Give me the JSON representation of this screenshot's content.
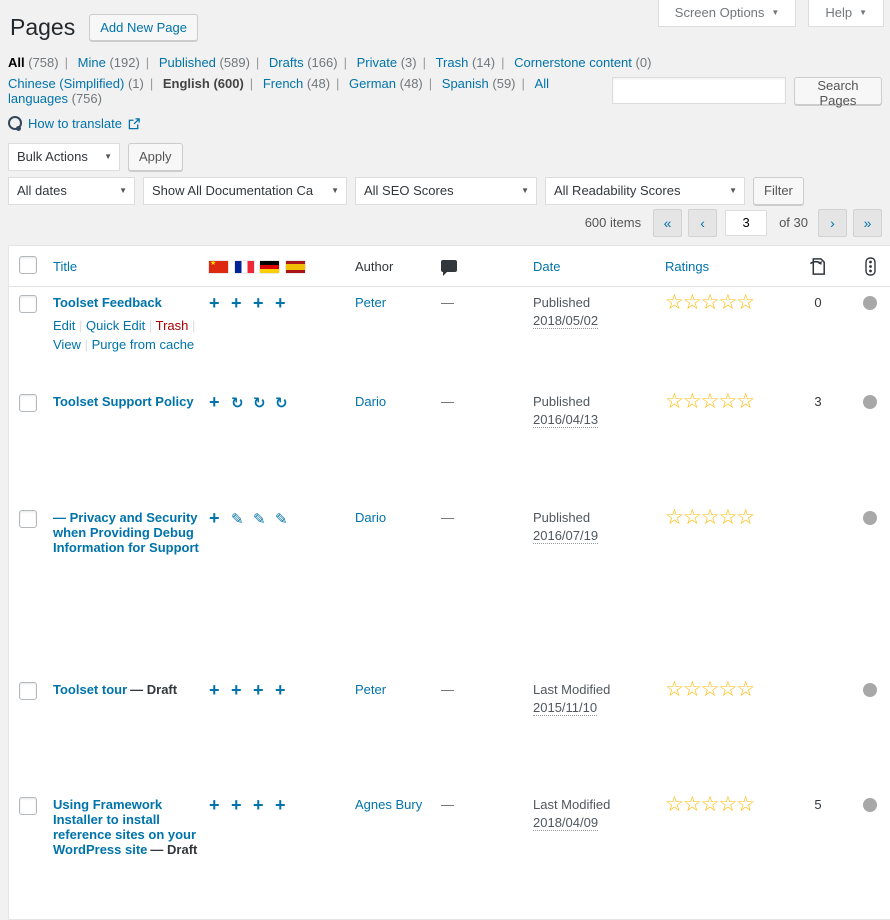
{
  "colors": {
    "accent_blue": "#0073aa",
    "star_gold": "#ffb900",
    "dot_gray": "#a8a8a8",
    "dot_orange": "#ee7c1b",
    "dot_green": "#7ad03a",
    "trash_red": "#a00000"
  },
  "icons": {
    "dropdown_arrow": "▼",
    "select_arrow": "▼"
  },
  "screen_meta": {
    "screen_options_label": "Screen Options",
    "help_label": "Help"
  },
  "header": {
    "title": "Pages",
    "add_new_label": "Add New Page"
  },
  "status_filters": {
    "items": [
      {
        "label": "All",
        "count": "(758)",
        "current": true
      },
      {
        "label": "Mine",
        "count": "(192)"
      },
      {
        "label": "Published",
        "count": "(589)"
      },
      {
        "label": "Drafts",
        "count": "(166)"
      },
      {
        "label": "Private",
        "count": "(3)"
      },
      {
        "label": "Trash",
        "count": "(14)"
      },
      {
        "label": "Cornerstone content",
        "count": "(0)"
      }
    ]
  },
  "language_filters": {
    "items": [
      {
        "label": "Chinese (Simplified)",
        "count": "(1)"
      },
      {
        "label": "English",
        "count": "(600)",
        "current": true
      },
      {
        "label": "French",
        "count": "(48)"
      },
      {
        "label": "German",
        "count": "(48)"
      },
      {
        "label": "Spanish",
        "count": "(59)"
      },
      {
        "label": "All languages",
        "count": "(756)"
      }
    ]
  },
  "search": {
    "value": "",
    "button_label": "Search Pages"
  },
  "translate": {
    "link_label": "How to translate"
  },
  "toolbar": {
    "bulk_actions_label": "Bulk Actions",
    "apply_label": "Apply",
    "dates_label": "All dates",
    "category_label": "Show All Documentation Ca",
    "seo_label": "All SEO Scores",
    "readability_label": "All Readability Scores",
    "filter_label": "Filter"
  },
  "pagination": {
    "items_count": "600 items",
    "first": "«",
    "prev": "‹",
    "current": "3",
    "of_total": "of 30",
    "next": "›",
    "last": "»"
  },
  "table": {
    "headers": {
      "title": "Title",
      "author": "Author",
      "date": "Date",
      "ratings": "Ratings"
    },
    "flag_languages": [
      "Chinese (Simplified)",
      "French",
      "German",
      "Spanish"
    ],
    "rows": [
      {
        "title": "Toolset Feedback",
        "state": "",
        "lang_icons": [
          "+",
          "+",
          "+",
          "+"
        ],
        "actions": [
          "Edit",
          "Quick Edit",
          "Trash",
          "View",
          "Purge from cache"
        ],
        "author": "Peter",
        "comments": "—",
        "date_label": "Published",
        "date": "2018/05/02",
        "stars": "☆☆☆☆☆",
        "count": "0",
        "seo": "gray",
        "readability": "orange"
      },
      {
        "title": "Toolset Support Policy",
        "state": "",
        "lang_icons": [
          "+",
          "↻",
          "↻",
          "↻"
        ],
        "author": "Dario",
        "comments": "—",
        "date_label": "Published",
        "date": "2016/04/13",
        "stars": "☆☆☆☆☆",
        "count": "3",
        "seo": "gray",
        "readability": "orange"
      },
      {
        "title": "— Privacy and Security when Providing Debug Information for Support",
        "state": "",
        "lang_icons": [
          "+",
          "✎",
          "✎",
          "✎"
        ],
        "author": "Dario",
        "comments": "—",
        "date_label": "Published",
        "date": "2016/07/19",
        "stars": "☆☆☆☆☆",
        "count": "",
        "seo": "gray",
        "readability": "green"
      },
      {
        "title": "Toolset tour",
        "state": "— Draft",
        "lang_icons": [
          "+",
          "+",
          "+",
          "+"
        ],
        "author": "Peter",
        "comments": "—",
        "date_label": "Last Modified",
        "date": "2015/11/10",
        "stars": "☆☆☆☆☆",
        "count": "",
        "seo": "gray",
        "readability": "gray"
      },
      {
        "title": "Using Framework Installer to install reference sites on your WordPress site",
        "state": "— Draft",
        "lang_icons": [
          "+",
          "+",
          "+",
          "+"
        ],
        "author": "Agnes Bury",
        "comments": "—",
        "date_label": "Last Modified",
        "date": "2018/04/09",
        "stars": "☆☆☆☆☆",
        "count": "5",
        "seo": "gray",
        "readability": "orange"
      }
    ]
  }
}
